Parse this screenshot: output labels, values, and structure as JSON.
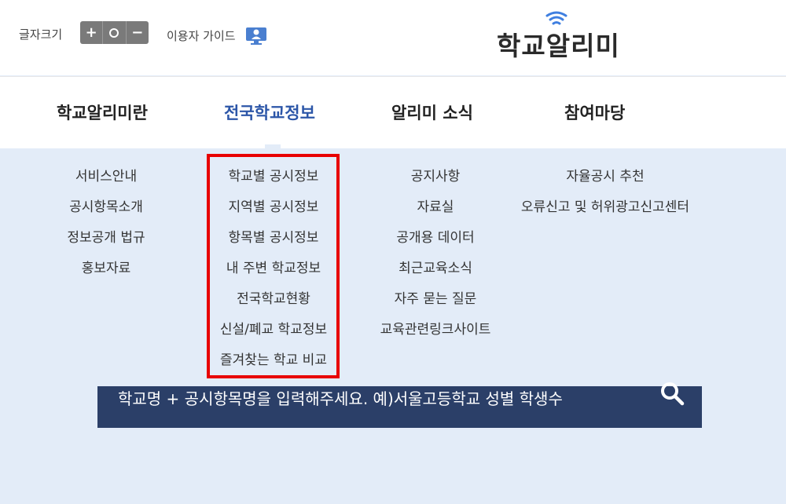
{
  "header": {
    "font_size_label": "글자크기",
    "font_buttons": [
      "+",
      "○",
      "−"
    ],
    "guide_label": "이용자 가이드",
    "logo_text": "학교알리미"
  },
  "nav": [
    {
      "label": "학교알리미란",
      "active": false
    },
    {
      "label": "전국학교정보",
      "active": true
    },
    {
      "label": "알리미 소식",
      "active": false
    },
    {
      "label": "참여마당",
      "active": false
    }
  ],
  "menus": [
    [
      "서비스안내",
      "공시항목소개",
      "정보공개 법규",
      "홍보자료"
    ],
    [
      "학교별 공시정보",
      "지역별 공시정보",
      "항목별 공시정보",
      "내 주변 학교정보",
      "전국학교현황",
      "신설/폐교 학교정보",
      "즐겨찾는 학교 비교"
    ],
    [
      "공지사항",
      "자료실",
      "공개용 데이터",
      "최근교육소식",
      "자주 묻는 질문",
      "교육관련링크사이트"
    ],
    [
      "자율공시 추천",
      "오류신고 및 허위광고신고센터"
    ]
  ],
  "search": {
    "placeholder": "학교명 + 공시항목명을 입력해주세요. 예)서울고등학교 성별 학생수"
  },
  "colors": {
    "accent": "#2c56a8",
    "highlight": "#e80000",
    "search_bg": "#2b3f68",
    "panel_bg": "#e3ecf8"
  }
}
